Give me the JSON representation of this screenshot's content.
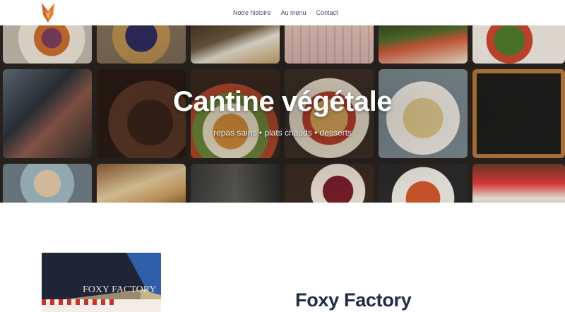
{
  "header": {
    "logo_icon": "fox-logo-icon",
    "nav": [
      {
        "label": "Notre histoire"
      },
      {
        "label": "Au menu"
      },
      {
        "label": "Contact"
      }
    ]
  },
  "hero": {
    "title": "Cantine végétale",
    "subtitle": "repas sains • plats chauds • desserts"
  },
  "storefront": {
    "sign_text": "FOXY FACTORY"
  },
  "section": {
    "title": "Foxy Factory"
  },
  "colors": {
    "nav_text": "#3e4f66",
    "heading": "#1f2c45",
    "logo_orange": "#e8782f"
  }
}
